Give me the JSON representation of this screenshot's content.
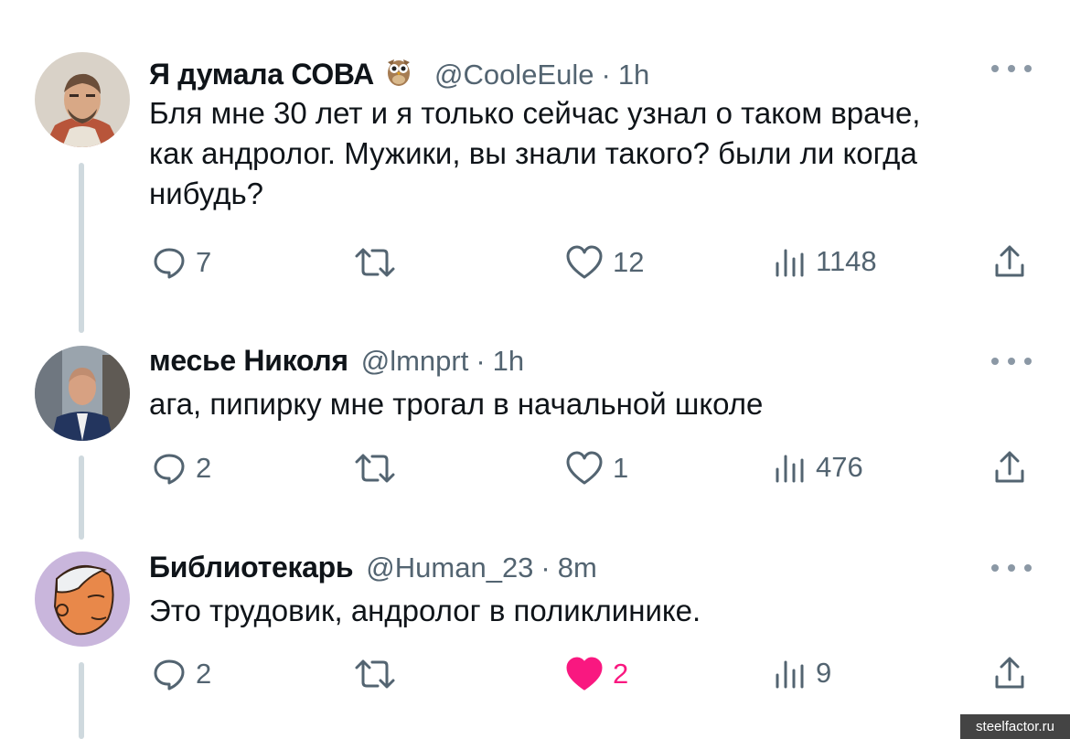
{
  "tweets": [
    {
      "name": "Я думала СОВА",
      "emoji": "owl",
      "handle": "@CooleEule",
      "separator": "·",
      "time": "1h",
      "lines": [
        "Бля мне 30 лет и я только сейчас узнал о таком враче,",
        "как андролог. Мужики, вы знали такого? были ли когда",
        "нибудь?"
      ],
      "replies": "7",
      "likes": "12",
      "views": "1148",
      "liked": false
    },
    {
      "name": "месье Николя",
      "handle": "@lmnprt",
      "separator": "·",
      "time": "1h",
      "lines": [
        "ага, пипирку мне трогал в начальной школе"
      ],
      "replies": "2",
      "likes": "1",
      "views": "476",
      "liked": false
    },
    {
      "name": "Библиотекарь",
      "handle": "@Human_23",
      "separator": "·",
      "time": "8m",
      "lines": [
        "Это трудовик, андролог в поликлинике."
      ],
      "replies": "2",
      "likes": "2",
      "views": "9",
      "liked": true
    }
  ],
  "icons": {
    "reply": "reply-icon",
    "retweet": "retweet-icon",
    "like": "heart-icon",
    "views": "views-icon",
    "share": "share-icon",
    "more": "more-icon"
  },
  "colors": {
    "like_active": "#f91880",
    "secondary_text": "#536471",
    "thread_line": "#cfd9de"
  },
  "watermark": "steelfactor.ru"
}
